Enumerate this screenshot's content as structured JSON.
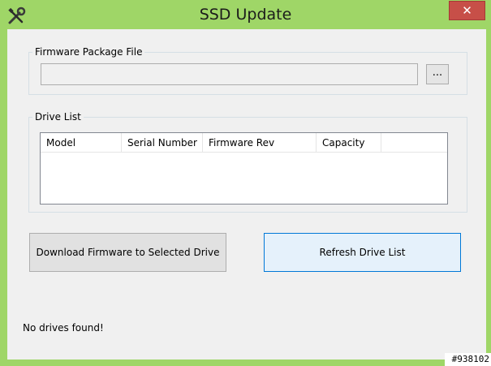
{
  "window": {
    "title": "SSD Update",
    "close_label": "✕",
    "app_icon": "tools-icon"
  },
  "firmware": {
    "group_label": "Firmware Package File",
    "path_value": "",
    "browse_label": "..."
  },
  "drives": {
    "group_label": "Drive List",
    "columns": [
      "Model",
      "Serial Number",
      "Firmware Rev",
      "Capacity"
    ],
    "rows": []
  },
  "actions": {
    "download_label": "Download Firmware to Selected Drive",
    "refresh_label": "Refresh Drive List"
  },
  "status": {
    "text": "No drives found!"
  },
  "watermark": "#938102",
  "colors": {
    "frame": "#9fd667",
    "close": "#c74f48",
    "focus_border": "#0078d7"
  }
}
